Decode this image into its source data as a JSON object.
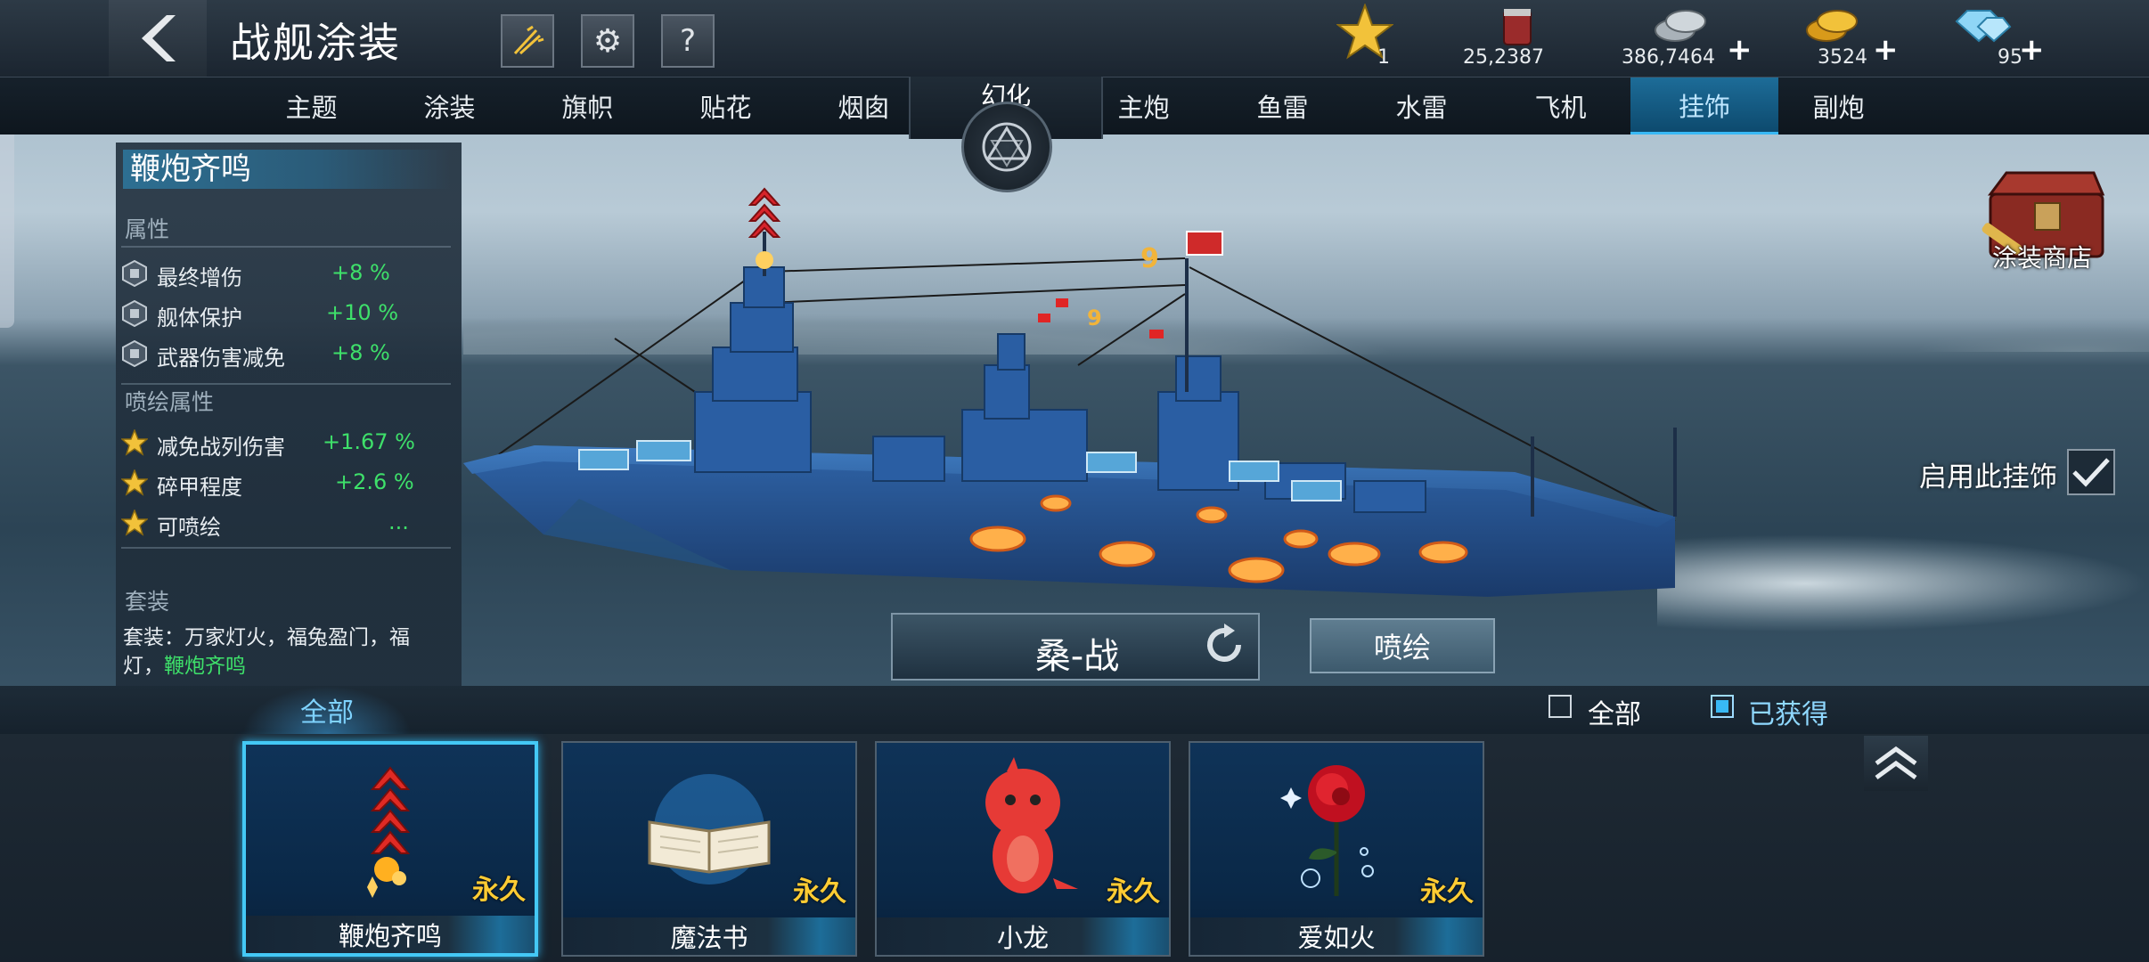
{
  "header": {
    "title": "战舰涂装",
    "back_icon": "back-chevron-icon",
    "buttons": [
      "firework-icon",
      "gear-icon",
      "help-icon"
    ]
  },
  "currencies": [
    {
      "name": "star-icon",
      "value": "1",
      "has_plus": false
    },
    {
      "name": "paint-bucket-icon",
      "value": "25,2387",
      "has_plus": false
    },
    {
      "name": "silver-coin-icon",
      "value": "386,7464",
      "has_plus": true
    },
    {
      "name": "gold-coin-icon",
      "value": "3524",
      "has_plus": true
    },
    {
      "name": "diamond-icon",
      "value": "95",
      "has_plus": true
    }
  ],
  "tabs_left": [
    "主题",
    "涂装",
    "旗帜",
    "贴花",
    "烟囱"
  ],
  "huanhua": "幻化",
  "tabs_right": [
    "主炮",
    "鱼雷",
    "水雷",
    "飞机",
    "挂饰",
    "副炮"
  ],
  "active_tab": "挂饰",
  "attr_panel": {
    "title": "鞭炮齐鸣",
    "attr_section": "属性",
    "attrs": [
      {
        "name": "最终增伤",
        "value": "+8 %"
      },
      {
        "name": "舰体保护",
        "value": "+10 %"
      },
      {
        "name": "武器伤害减免",
        "value": "+8 %"
      }
    ],
    "spray_section": "喷绘属性",
    "spray_attrs": [
      {
        "name": "减免战列伤害",
        "value": "+1.67 %"
      },
      {
        "name": "碎甲程度",
        "value": "+2.6 %"
      },
      {
        "name": "可喷绘",
        "value": "..."
      }
    ],
    "set_section": "套装",
    "set_prefix": "套装：万家灯火，福兔盈门，福灯，",
    "set_highlight": "鞭炮齐鸣"
  },
  "shop_label": "涂装商店",
  "enable_label": "启用此挂饰",
  "ship_name": "桑-战",
  "spray_button": "喷绘",
  "filter": {
    "tab": "全部",
    "option_all": "全部",
    "option_owned": "已获得",
    "owned_checked": true
  },
  "items": [
    {
      "name": "鞭炮齐鸣",
      "duration": "永久",
      "icon": "firecracker-icon",
      "selected": true
    },
    {
      "name": "魔法书",
      "duration": "永久",
      "icon": "magic-book-icon",
      "selected": false
    },
    {
      "name": "小龙",
      "duration": "永久",
      "icon": "little-dragon-icon",
      "selected": false
    },
    {
      "name": "爱如火",
      "duration": "永久",
      "icon": "rose-icon",
      "selected": false
    }
  ],
  "colors": {
    "accent": "#38b9f5",
    "positive": "#3ee06a",
    "duration": "#ffcc33"
  }
}
